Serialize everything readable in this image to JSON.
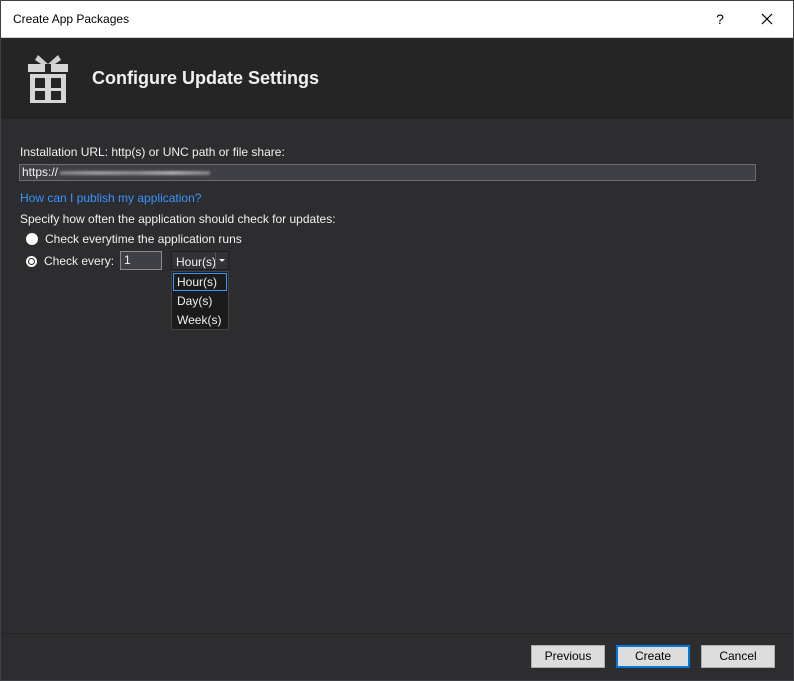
{
  "window": {
    "title": "Create App Packages",
    "help_glyph": "?"
  },
  "header": {
    "heading": "Configure Update Settings",
    "icon": "gift-box-icon"
  },
  "form": {
    "url_label": "Installation URL: http(s) or UNC path or file share:",
    "url_value": "https://",
    "publish_link": "How can I publish my application?",
    "frequency_label": "Specify how often the application should check for updates:",
    "options": [
      {
        "label": "Check everytime the application runs",
        "selected": false
      },
      {
        "label": "Check every:",
        "selected": true
      }
    ],
    "interval_value": "1",
    "unit": {
      "selected": "Hour(s)",
      "options": [
        "Hour(s)",
        "Day(s)",
        "Week(s)"
      ],
      "highlighted": "Hour(s)"
    }
  },
  "footer": {
    "previous_label": "Previous",
    "create_label": "Create",
    "cancel_label": "Cancel"
  },
  "colors": {
    "background": "#2d2d30",
    "header_band": "#252526",
    "link": "#3794ff",
    "focus": "#3399ff"
  }
}
